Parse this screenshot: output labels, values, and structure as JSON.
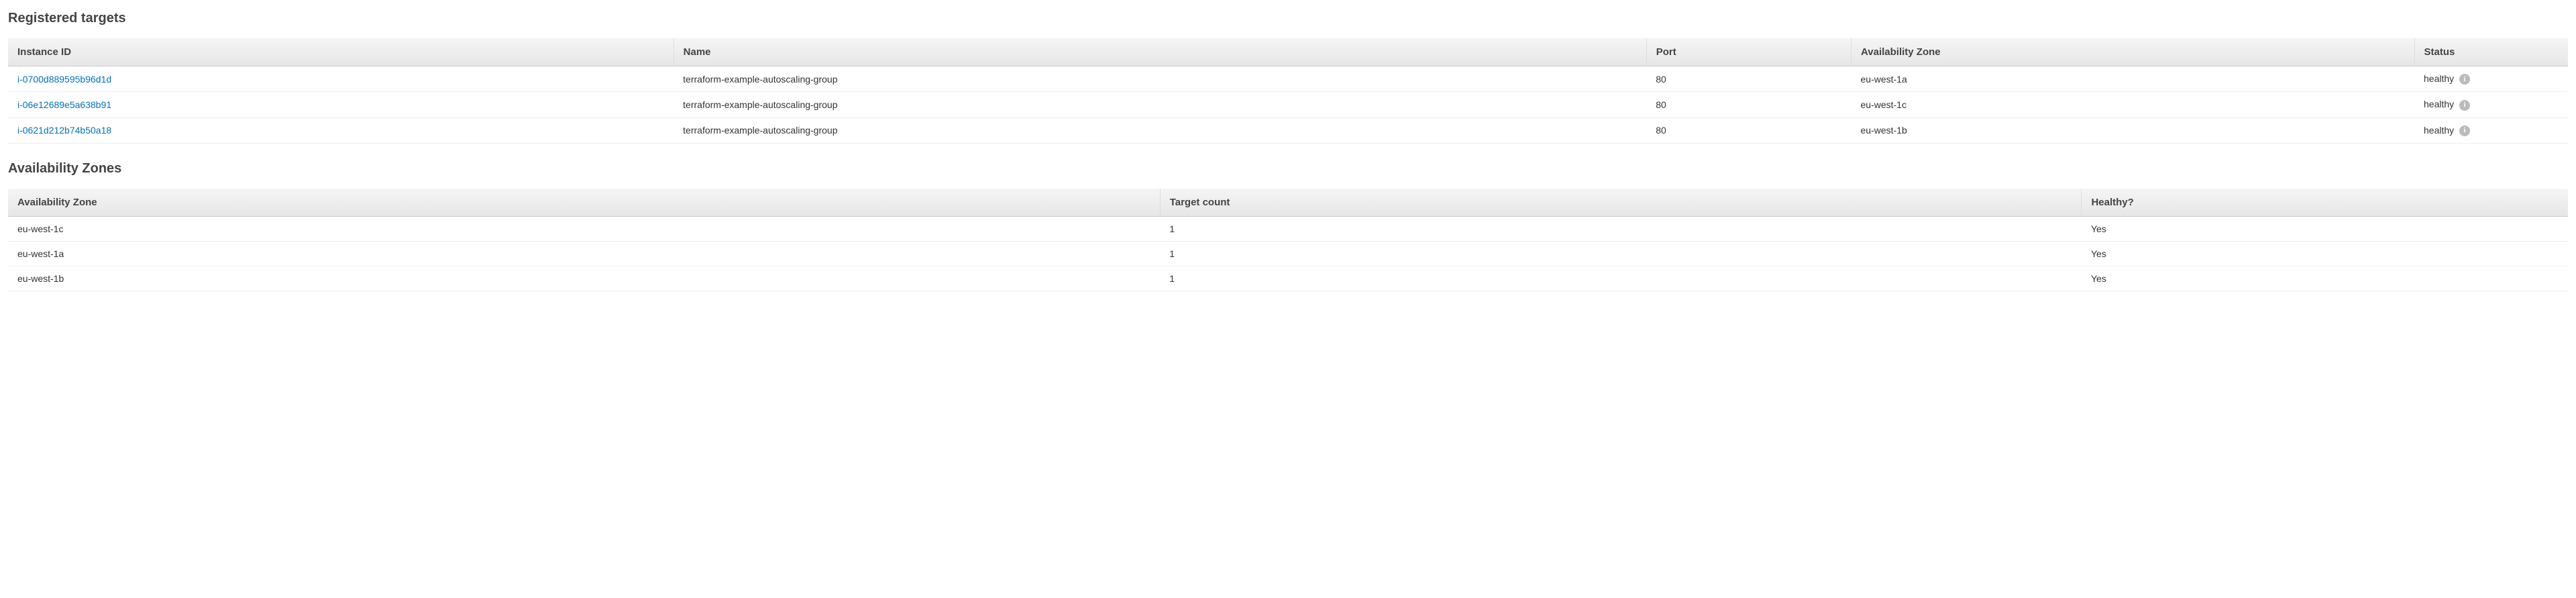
{
  "sections": {
    "targets": {
      "title": "Registered targets",
      "columns": {
        "instance_id": "Instance ID",
        "name": "Name",
        "port": "Port",
        "az": "Availability Zone",
        "status": "Status"
      },
      "rows": [
        {
          "instance_id": "i-0700d889595b96d1d",
          "name": "terraform-example-autoscaling-group",
          "port": "80",
          "az": "eu-west-1a",
          "status": "healthy"
        },
        {
          "instance_id": "i-06e12689e5a638b91",
          "name": "terraform-example-autoscaling-group",
          "port": "80",
          "az": "eu-west-1c",
          "status": "healthy"
        },
        {
          "instance_id": "i-0621d212b74b50a18",
          "name": "terraform-example-autoscaling-group",
          "port": "80",
          "az": "eu-west-1b",
          "status": "healthy"
        }
      ]
    },
    "zones": {
      "title": "Availability Zones",
      "columns": {
        "az": "Availability Zone",
        "count": "Target count",
        "healthy": "Healthy?"
      },
      "rows": [
        {
          "az": "eu-west-1c",
          "count": "1",
          "healthy": "Yes"
        },
        {
          "az": "eu-west-1a",
          "count": "1",
          "healthy": "Yes"
        },
        {
          "az": "eu-west-1b",
          "count": "1",
          "healthy": "Yes"
        }
      ]
    }
  }
}
